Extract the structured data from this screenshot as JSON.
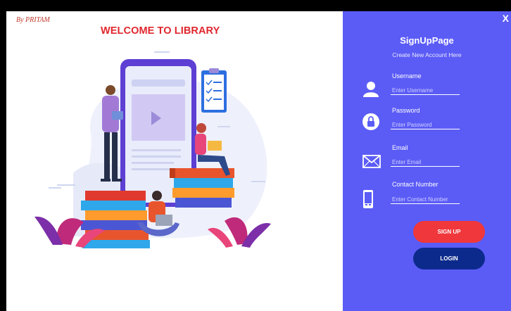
{
  "left_panel": {
    "author": "By PRITAM",
    "welcome": "WELCOME TO LIBRARY"
  },
  "right_panel": {
    "close": "X",
    "title": "SignUpPage",
    "subtitle": "Create New Account Here",
    "fields": [
      {
        "label": "Username",
        "placeholder": "Enter Username",
        "icon": "user-icon"
      },
      {
        "label": "Password",
        "placeholder": "Enter Password",
        "icon": "lock-icon"
      },
      {
        "label": "Email",
        "placeholder": "Enter Email",
        "icon": "envelope-icon"
      },
      {
        "label": "Contact Number",
        "placeholder": "Enter Contact Number",
        "icon": "phone-icon"
      }
    ],
    "signup_label": "SIGN UP",
    "login_label": "LOGIN"
  },
  "colors": {
    "panel_bg": "#5b5cf6",
    "signup_bg": "#f0373b",
    "login_bg": "#0c2a8c",
    "welcome_text": "#e0262e"
  }
}
